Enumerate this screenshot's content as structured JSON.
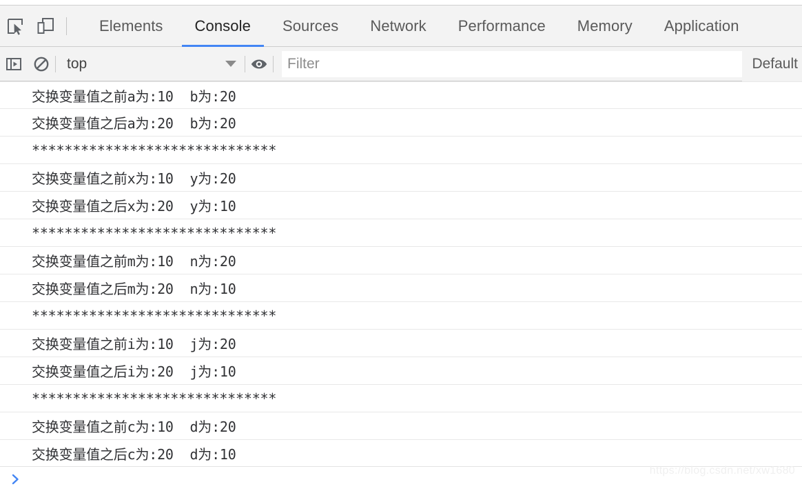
{
  "window": {
    "app": "Chrome DevTools",
    "watermark": "https://blog.csdn.net/xw1680"
  },
  "tabbar": {
    "inspect_icon": "inspect-cursor-icon",
    "device_icon": "device-toolbar-icon",
    "tabs": [
      {
        "label": "Elements",
        "active": false
      },
      {
        "label": "Console",
        "active": true
      },
      {
        "label": "Sources",
        "active": false
      },
      {
        "label": "Network",
        "active": false
      },
      {
        "label": "Performance",
        "active": false
      },
      {
        "label": "Memory",
        "active": false
      },
      {
        "label": "Application",
        "active": false
      }
    ],
    "active_tab": "Console",
    "active_underline_color": "#4285f4"
  },
  "consolebar": {
    "sidebar_toggle_icon": "console-sidebar-icon",
    "clear_icon": "clear-console-icon",
    "context": {
      "value": "top",
      "caret_icon": "chevron-down-icon"
    },
    "eye_icon": "live-expression-eye-icon",
    "filter": {
      "value": "",
      "placeholder": "Filter"
    },
    "levels": {
      "value": "Default"
    }
  },
  "console": {
    "messages": [
      "交换变量值之前a为:10  b为:20",
      "交换变量值之后a为:20  b为:20",
      "******************************",
      "交换变量值之前x为:10  y为:20",
      "交换变量值之后x为:20  y为:10",
      "******************************",
      "交换变量值之前m为:10  n为:20",
      "交换变量值之后m为:20  n为:10",
      "******************************",
      "交换变量值之前i为:10  j为:20",
      "交换变量值之后i为:20  j为:10",
      "******************************",
      "交换变量值之前c为:10  d为:20",
      "交换变量值之后c为:20  d为:10"
    ]
  },
  "prompt": {
    "chevron_icon": "prompt-chevron-icon",
    "value": "",
    "placeholder": ""
  }
}
